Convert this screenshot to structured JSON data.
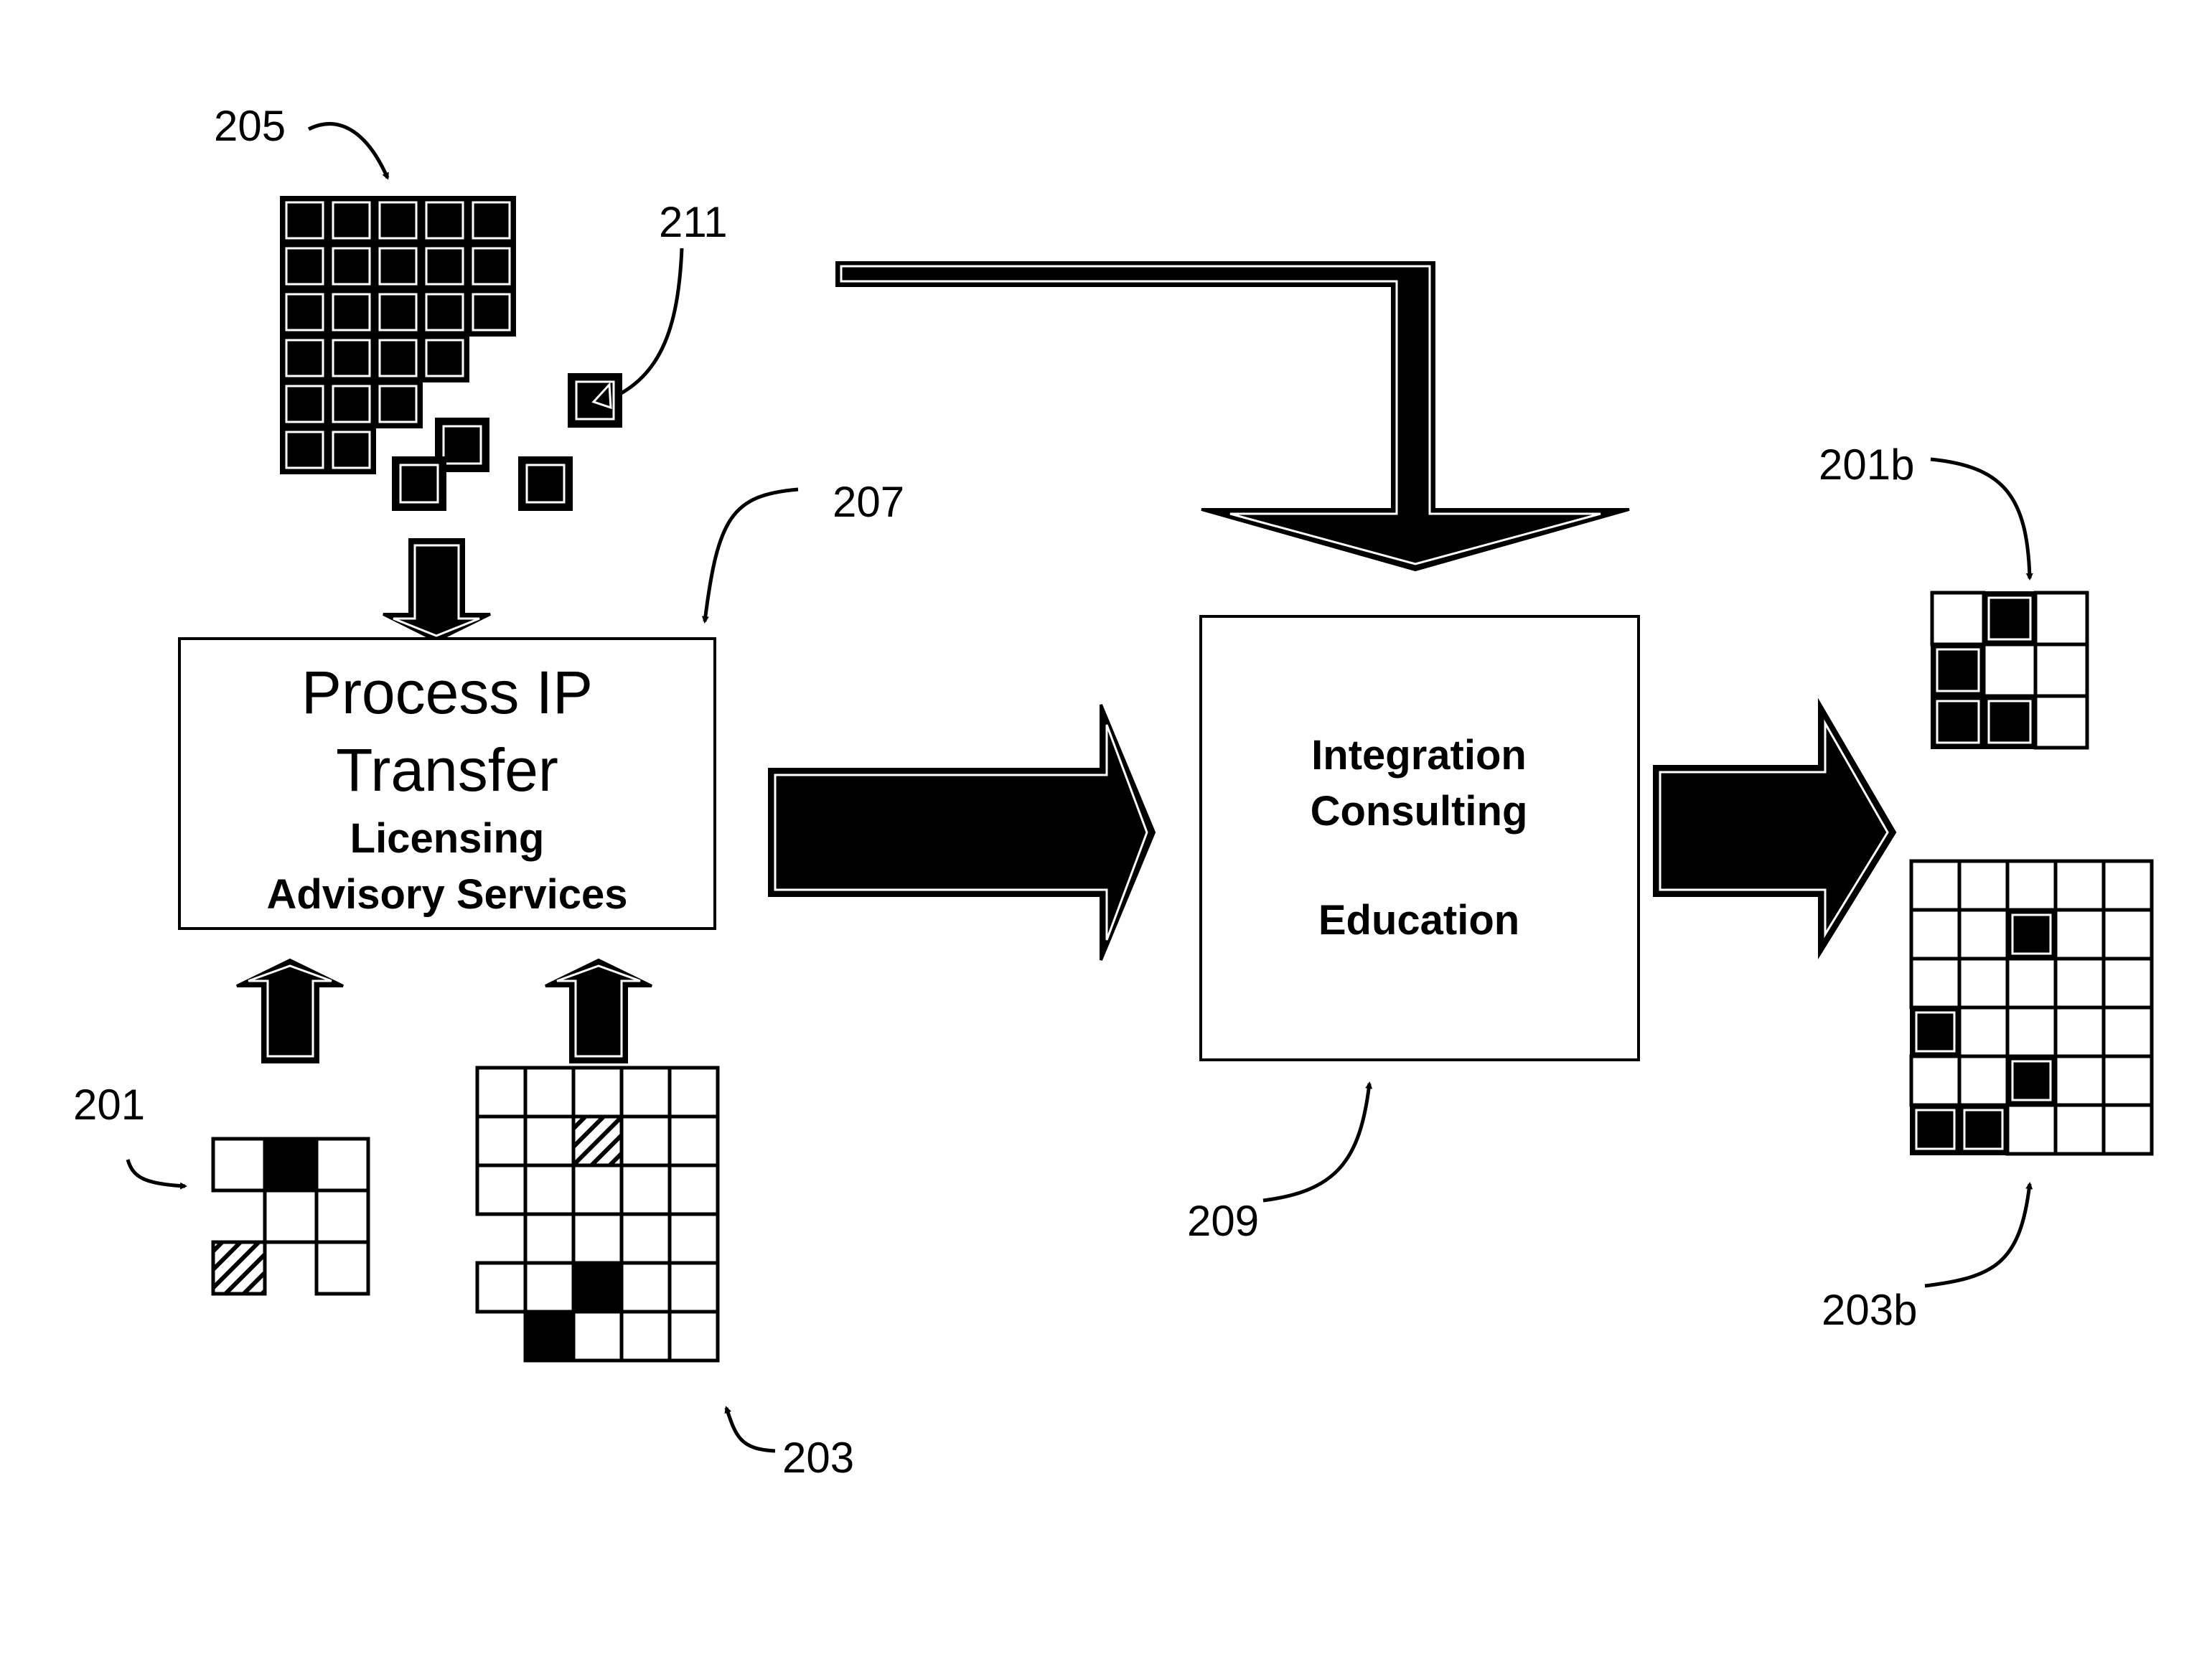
{
  "figure": {
    "reference_labels": {
      "r205": "205",
      "r211": "211",
      "r207": "207",
      "r201": "201",
      "r203": "203",
      "r209": "209",
      "r201b": "201b",
      "r203b": "203b"
    },
    "box_207": {
      "lines": [
        "Process IP",
        "Transfer",
        "Licensing",
        "Advisory Services"
      ]
    },
    "box_209": {
      "lines": [
        "Integration",
        "Consulting",
        "Education"
      ]
    },
    "grids": {
      "g205": {
        "description": "dark block arrangement",
        "rows": [
          [
            "B",
            "B",
            "B",
            "B",
            "B"
          ],
          [
            "B",
            "B",
            "B",
            "B",
            "B"
          ],
          [
            "B",
            "B",
            "B",
            "B",
            "B"
          ],
          [
            "B",
            "B",
            "B",
            "B",
            "-"
          ],
          [
            "B",
            "B",
            "B",
            "-",
            "-"
          ],
          [
            "B",
            "B",
            "-",
            "-",
            "-"
          ]
        ],
        "loose_blocks": 3,
        "marked_block": "211"
      },
      "g201": {
        "rows": [
          [
            "W",
            "B",
            "W"
          ],
          [
            "-",
            "W",
            "W"
          ],
          [
            "H",
            "-",
            "W"
          ]
        ]
      },
      "g203": {
        "rows": [
          [
            "W",
            "W",
            "W",
            "W",
            "W"
          ],
          [
            "W",
            "W",
            "H",
            "W",
            "W"
          ],
          [
            "W",
            "W",
            "W",
            "W",
            "W"
          ],
          [
            "-",
            "W",
            "W",
            "W",
            "W"
          ],
          [
            "W",
            "W",
            "B",
            "W",
            "W"
          ],
          [
            "-",
            "B",
            "W",
            "W",
            "W"
          ]
        ]
      },
      "g201b": {
        "rows": [
          [
            "W",
            "B",
            "W"
          ],
          [
            "B",
            "W",
            "W"
          ],
          [
            "B",
            "B",
            "W"
          ]
        ]
      },
      "g203b": {
        "rows": [
          [
            "W",
            "W",
            "W",
            "W",
            "W"
          ],
          [
            "W",
            "W",
            "B",
            "W",
            "W"
          ],
          [
            "W",
            "W",
            "W",
            "W",
            "W"
          ],
          [
            "B",
            "W",
            "W",
            "W",
            "W"
          ],
          [
            "W",
            "W",
            "B",
            "W",
            "W"
          ],
          [
            "B",
            "B",
            "W",
            "W",
            "W"
          ]
        ]
      }
    },
    "legend": {
      "B": "filled",
      "W": "empty",
      "H": "hatched",
      "-": "absent"
    }
  }
}
